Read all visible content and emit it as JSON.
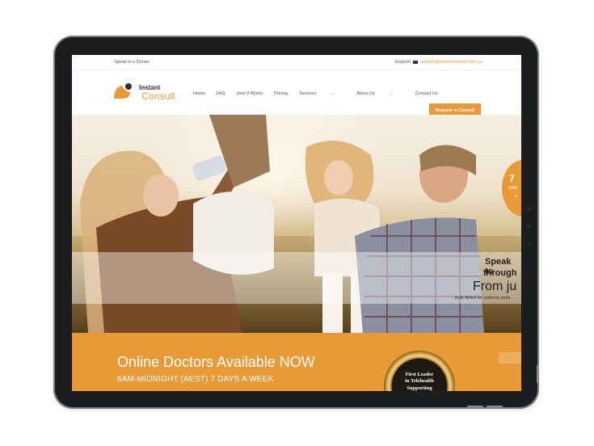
{
  "topbar": {
    "left_text": "Speak to a Doctor",
    "support_label": "Support",
    "email": "support@instantconsult.com.au"
  },
  "brand": {
    "name_line1": "Instant",
    "name_line2": "Consult",
    "accent_color": "#e89a37"
  },
  "nav": {
    "items": [
      {
        "label": "Home"
      },
      {
        "label": "FAQ"
      },
      {
        "label": "How It Works"
      },
      {
        "label": "Pricing"
      },
      {
        "label": "Services"
      },
      {
        "label": "About Us"
      },
      {
        "label": "Contact Us"
      }
    ],
    "cta_label": "Request a Consult"
  },
  "hero": {
    "badge": {
      "line1": "7",
      "line2": "com",
      "line3": "c"
    },
    "headline_1": "Speak to",
    "headline_2": "through",
    "headline_3": "From ju",
    "subtext": "Bulk-Billed for patients unde"
  },
  "banner": {
    "title": "Online Doctors Available NOW",
    "subtitle": "6AM-MIDNIGHT (AEST) 7 DAYS A WEEK",
    "medal_lines": [
      "First Leader",
      "in Telehealth",
      "Supporting"
    ]
  }
}
